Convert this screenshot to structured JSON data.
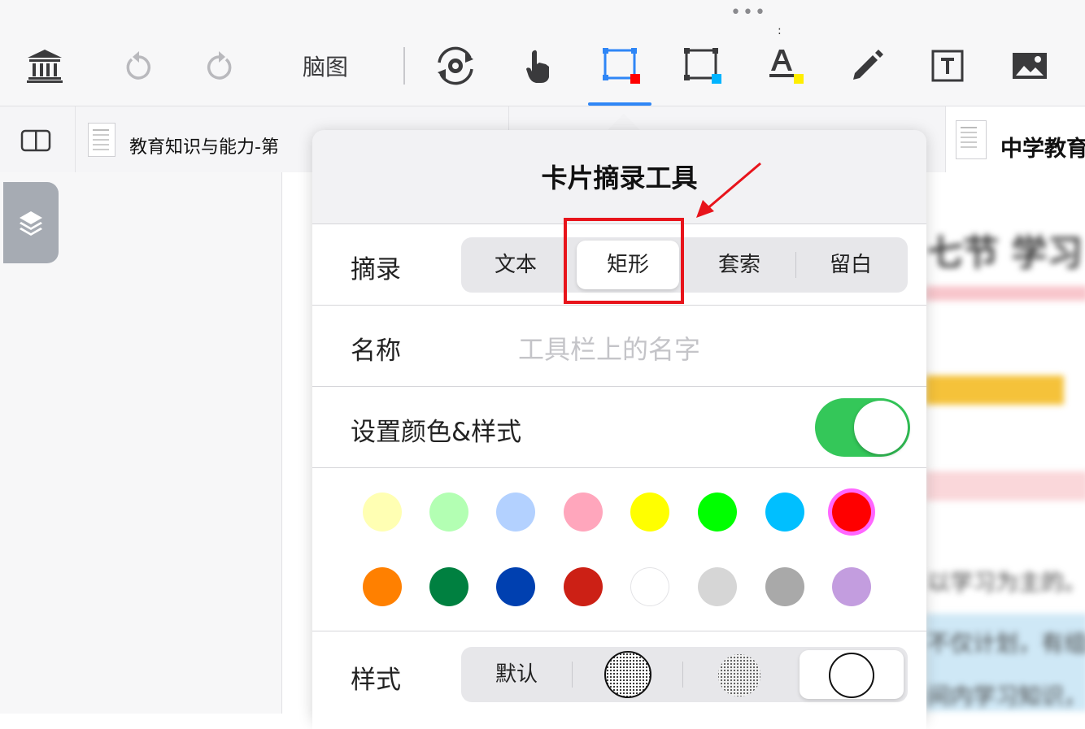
{
  "toolbar": {
    "more_dots": "•••",
    "colon": ":",
    "mindmap_label": "脑图",
    "icons": [
      "library-icon",
      "undo-icon",
      "redo-icon",
      "rotate-settings-icon",
      "hand-pointer-icon",
      "rect-excerpt-red-icon",
      "rect-excerpt-blue-icon",
      "text-highlight-icon",
      "pencil-icon",
      "text-box-icon",
      "image-icon"
    ]
  },
  "tabs": {
    "tab1_label": "教育知识与能力-第",
    "tab3_label": "中学教育"
  },
  "background_text": {
    "line1": "七节  学习",
    "line2": "以学习为主的。",
    "line3": "不仅计划，有组织",
    "line4": "间内学习知识，"
  },
  "popover": {
    "title": "卡片摘录工具",
    "excerpt_label": "摘录",
    "excerpt_options": [
      "文本",
      "矩形",
      "套索",
      "留白"
    ],
    "excerpt_selected": "矩形",
    "name_label": "名称",
    "name_placeholder": "工具栏上的名字",
    "color_style_label": "设置颜色&样式",
    "color_style_enabled": true,
    "colors_row1": [
      "#ffffb3",
      "#b3ffb3",
      "#b3d1ff",
      "#ffa6bc",
      "#ffff00",
      "#00ff00",
      "#00bfff",
      "#ff0000"
    ],
    "colors_row2": [
      "#ff8000",
      "#008040",
      "#0040b0",
      "#cc2015",
      "#ffffff",
      "#d6d6d6",
      "#a9a9a9",
      "#c39ddf"
    ],
    "selected_color": "#ff0000",
    "style_label": "样式",
    "style_options": [
      "默认",
      "dotted-circle-outlined",
      "dotted-circle",
      "empty-circle"
    ],
    "style_default_label": "默认",
    "style_selected": "empty-circle"
  },
  "annotation": {
    "box_color": "#e8141b"
  }
}
